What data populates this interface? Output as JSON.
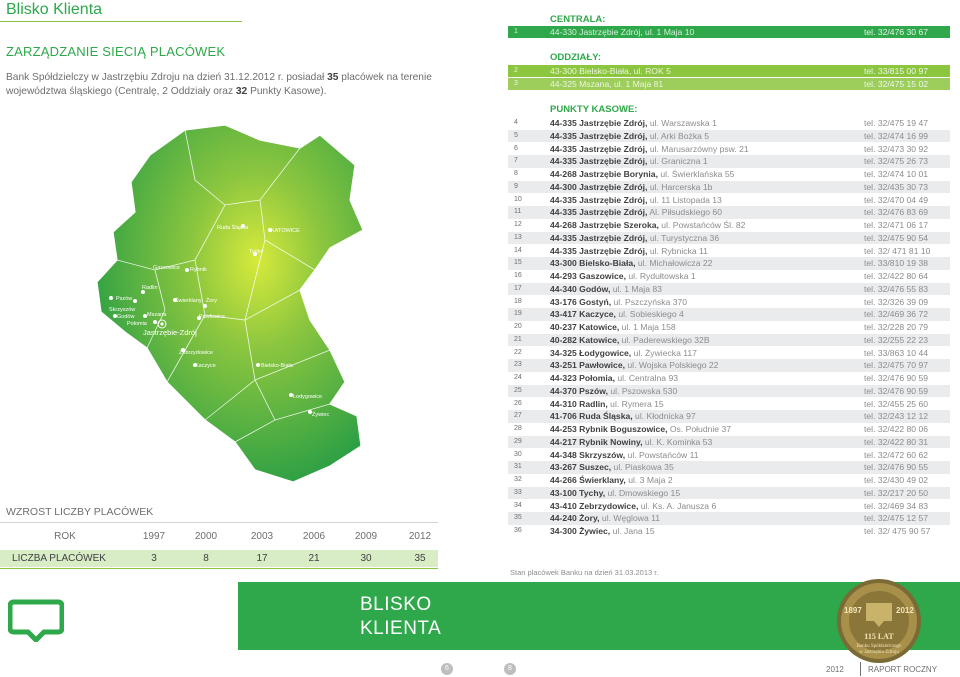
{
  "page_title": "Blisko Klienta",
  "heading": "ZARZĄDZANIE SIECIĄ PLACÓWEK",
  "intro": {
    "before": "Bank Spółdzielczy w Jastrzębiu Zdroju na dzień 31.12.2012 r. posiadał ",
    "branches": "35",
    "middle": " placówek na terenie województwa śląskiego (Centralę, 2 Oddziały oraz ",
    "cash_points": "32",
    "after": " Punkty Kasowe)."
  },
  "map_labels": {
    "gaszowice": "Gaszowice",
    "rybnik": "Rybnik",
    "radlin": "Radlin",
    "pszow": "Pszów",
    "swierklany": "Świerklany",
    "zory": "Żory",
    "skrzyszow": "Skrzyszów",
    "godow": "Godów",
    "mszana": "Mszana",
    "polomia": "Połomia",
    "pawlowice": "Pawłowice",
    "jastrzebie": "Jastrzębie-Zdrój",
    "ruda": "Ruda Śląska",
    "katowice": "KATOWICE",
    "tychy": "Tychy",
    "zebrzydowice": "Zebrzydowice",
    "kaczyce": "Kaczyce",
    "bielsko": "Bielsko-Biała",
    "lodygowice": "Łodygowice",
    "zywiec": "Żywiec"
  },
  "growth": {
    "title": "WZROST LICZBY PLACÓWEK",
    "year_label": "ROK",
    "count_label": "LICZBA PLACÓWEK",
    "years": [
      "1997",
      "2000",
      "2003",
      "2006",
      "2009",
      "2012"
    ],
    "counts": [
      "3",
      "8",
      "17",
      "21",
      "30",
      "35"
    ]
  },
  "centrala": {
    "header": "CENTRALA:",
    "rows": [
      {
        "no": "1",
        "city": "44-330 Jastrzębie Zdrój,",
        "street": " ul. 1 Maja 10",
        "tel": "tel. 32/476 30 67"
      }
    ]
  },
  "oddzialy": {
    "header": "ODDZIAŁY:",
    "rows": [
      {
        "no": "2",
        "city": "43-300 Bielsko-Biała,",
        "street": " ul. ROK 5",
        "tel": "tel. 33/815 00 97"
      },
      {
        "no": "3",
        "city": "44-325 Mszana,",
        "street": " ul. 1 Maja 81",
        "tel": "tel. 32/475 15 02"
      }
    ]
  },
  "punkty": {
    "header": "PUNKTY KASOWE:",
    "rows": [
      {
        "no": "4",
        "city": "44-335 Jastrzębie Zdrój,",
        "street": " ul. Warszawska 1",
        "tel": "tel. 32/475 19 47"
      },
      {
        "no": "5",
        "city": "44-335 Jastrzębie Zdrój,",
        "street": " ul. Arki Bożka 5",
        "tel": "tel. 32/474 16 99"
      },
      {
        "no": "6",
        "city": "44-335 Jastrzębie Zdrój,",
        "street": " ul. Marusarzówny psw. 21",
        "tel": "tel. 32/473 30 92"
      },
      {
        "no": "7",
        "city": "44-335 Jastrzębie Zdrój,",
        "street": " ul. Graniczna 1",
        "tel": "tel. 32/475 26 73"
      },
      {
        "no": "8",
        "city": "44-268 Jastrzębie Borynia,",
        "street": " ul. Świerklańska 55",
        "tel": "tel. 32/474 10 01"
      },
      {
        "no": "9",
        "city": "44-300 Jastrzębie Zdrój,",
        "street": " ul. Harcerska 1b",
        "tel": "tel. 32/435 30 73"
      },
      {
        "no": "10",
        "city": "44-335 Jastrzębie Zdrój,",
        "street": " ul. 11 Listopada 13",
        "tel": "tel. 32/470 04 49"
      },
      {
        "no": "11",
        "city": "44-335 Jastrzębie Zdrój,",
        "street": " Al. Piłsudskiego 60",
        "tel": "tel. 32/476 83 69"
      },
      {
        "no": "12",
        "city": "44-268 Jastrzębie Szeroka,",
        "street": " ul. Powstańców Śl. 82",
        "tel": "tel. 32/471 06 17"
      },
      {
        "no": "13",
        "city": "44-335 Jastrzębie Zdrój,",
        "street": " ul. Turystyczna 36",
        "tel": "tel. 32/475 90 54"
      },
      {
        "no": "14",
        "city": "44-335 Jastrzębie Zdrój,",
        "street": " ul. Rybnicka 11",
        "tel": "tel. 32/ 471 81 10"
      },
      {
        "no": "15",
        "city": "43-300 Bielsko-Biała,",
        "street": " ul. Michałowicza 22",
        "tel": "tel. 33/810 19 38"
      },
      {
        "no": "16",
        "city": "44-293 Gaszowice,",
        "street": " ul. Rydułtowska 1",
        "tel": "tel. 32/422 80 64"
      },
      {
        "no": "17",
        "city": "44-340 Godów,",
        "street": " ul. 1 Maja 83",
        "tel": "tel. 32/476 55 83"
      },
      {
        "no": "18",
        "city": "43-176 Gostyń,",
        "street": " ul. Pszczyńska 370",
        "tel": "tel. 32/326 39 09"
      },
      {
        "no": "19",
        "city": "43-417 Kaczyce,",
        "street": " ul. Sobieskiego 4",
        "tel": "tel. 32/469 36 72"
      },
      {
        "no": "20",
        "city": "40-237 Katowice,",
        "street": " ul. 1 Maja 158",
        "tel": "tel. 32/228 20 79"
      },
      {
        "no": "21",
        "city": "40-282 Katowice,",
        "street": " ul. Paderewskiego 32B",
        "tel": "tel. 32/255 22 23"
      },
      {
        "no": "22",
        "city": "34-325 Łodygowice,",
        "street": " ul. Żywiecka 117",
        "tel": "tel. 33/863 10 44"
      },
      {
        "no": "23",
        "city": "43-251 Pawłowice,",
        "street": " ul. Wojska Polskiego 22",
        "tel": "tel. 32/475 70 97"
      },
      {
        "no": "24",
        "city": "44-323 Połomia,",
        "street": " ul. Centralna 93",
        "tel": "tel. 32/476 90 59"
      },
      {
        "no": "25",
        "city": "44-370 Pszów,",
        "street": " ul. Pszowska 530",
        "tel": "tel. 32/476 90 59"
      },
      {
        "no": "26",
        "city": "44-310 Radlin,",
        "street": " ul. Rymera 15",
        "tel": "tel. 32/455 25 60"
      },
      {
        "no": "27",
        "city": "41-706 Ruda Śląska,",
        "street": " ul. Kłodnicka 97",
        "tel": "tel. 32/243 12 12"
      },
      {
        "no": "28",
        "city": "44-253 Rybnik Boguszowice,",
        "street": " Os. Południe 37",
        "tel": "tel. 32/422 80 06"
      },
      {
        "no": "29",
        "city": "44-217 Rybnik Nowiny,",
        "street": " ul. K. Kominka 53",
        "tel": "tel. 32/422 80 31"
      },
      {
        "no": "30",
        "city": "44-348 Skrzyszów,",
        "street": " ul. Powstańców 11",
        "tel": "tel. 32/472 60 62"
      },
      {
        "no": "31",
        "city": "43-267 Suszec,",
        "street": " ul. Piaskowa 35",
        "tel": "tel. 32/476 90 55"
      },
      {
        "no": "32",
        "city": "44-266 Świerklany,",
        "street": " ul. 3 Maja 2",
        "tel": "tel. 32/430 49 02"
      },
      {
        "no": "33",
        "city": "43-100 Tychy,",
        "street": " ul. Dmowskiego 15",
        "tel": "tel. 32/217 20 50"
      },
      {
        "no": "34",
        "city": "43-410 Zebrzydowice,",
        "street": " ul. Ks. A. Janusza 6",
        "tel": "tel. 32/469 34 83"
      },
      {
        "no": "35",
        "city": "44-240 Żory,",
        "street": " ul. Węglowa 11",
        "tel": "tel. 32/475 12 57"
      },
      {
        "no": "36",
        "city": "34-300 Żywiec,",
        "street": " ul. Jana 15",
        "tel": "tel. 32/ 475 90 57"
      }
    ]
  },
  "note": "Stan placówek Banku na dzień 31.03.2013 r.",
  "banner": {
    "line1": "BLISKO",
    "line2": "KLIENTA"
  },
  "medal": {
    "year_left": "1897",
    "year_right": "2012",
    "big": "115 LAT",
    "line1": "Banku Spółdzielczego",
    "line2": "w Jastrzębiu Zdroju"
  },
  "pages": {
    "left": "6",
    "right": "8"
  },
  "footer": {
    "year": "2012",
    "report": "RAPORT ROCZNY"
  },
  "colors": {
    "green": "#2ea84a",
    "light_green": "#8cc63f"
  }
}
